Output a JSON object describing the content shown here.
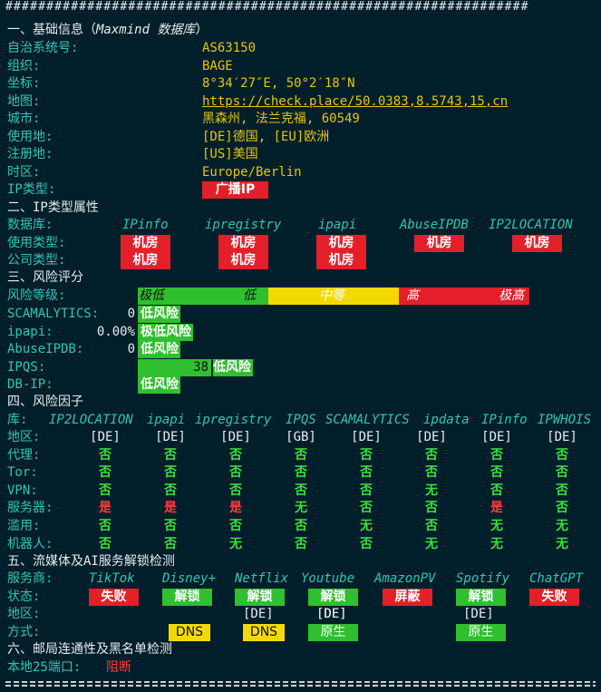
{
  "top_separator": "################################################################",
  "s1": {
    "title": "一、基础信息（",
    "title_db": "Maxmind 数据库",
    "title_end": "）",
    "rows": [
      {
        "label": "自治系统号:",
        "value": "AS63150"
      },
      {
        "label": "组织:",
        "value": "BAGE"
      },
      {
        "label": "坐标:",
        "value": "8°34′27″E, 50°2′18″N"
      },
      {
        "label": "地图:",
        "value": "https://check.place/50.0383,8.5743,15,cn"
      },
      {
        "label": "城市:",
        "value": "黑森州, 法兰克福, 60549"
      },
      {
        "label": "使用地:",
        "value": "[DE]德国, [EU]欧洲"
      },
      {
        "label": "注册地:",
        "value": "[US]美国"
      },
      {
        "label": "时区:",
        "value": "Europe/Berlin"
      }
    ],
    "ip_type_label": "IP类型:",
    "ip_type_value": "广播IP"
  },
  "s2": {
    "title": "二、IP类型属性",
    "db_label": "数据库:",
    "dbs": [
      "IPinfo",
      "ipregistry",
      "ipapi",
      "AbuseIPDB",
      "IP2LOCATION"
    ],
    "usage_label": "使用类型:",
    "usage": [
      "机房",
      "机房",
      "机房",
      "机房",
      "机房"
    ],
    "company_label": "公司类型:",
    "company": [
      "机房",
      "机房",
      "机房"
    ]
  },
  "s3": {
    "title": "三、风险评分",
    "level_label": "风险等级:",
    "levels": [
      "极低",
      "低",
      "中等",
      "高",
      "极高"
    ],
    "rows": [
      {
        "label": "SCAMALYTICS:",
        "score": "0",
        "text": "低风险",
        "fraction": 0
      },
      {
        "label": "ipapi:",
        "score": "0.00%",
        "text": "极低风险",
        "fraction": 0
      },
      {
        "label": "AbuseIPDB:",
        "score": "0",
        "text": "低风险",
        "fraction": 0
      },
      {
        "label": "IPQS:",
        "score": "38",
        "text": "低风险",
        "fraction": 0.38
      },
      {
        "label": "DB-IP:",
        "score": "",
        "text": "低风险",
        "fraction": 0
      }
    ]
  },
  "s4": {
    "title": "四、风险因子",
    "lib_label": "库:",
    "libs": [
      "IP2LOCATION",
      "ipapi",
      "ipregistry",
      "IPQS",
      "SCAMALYTICS",
      "ipdata",
      "IPinfo",
      "IPWHOIS"
    ],
    "rows": [
      {
        "label": "地区:",
        "cells": [
          "[DE]",
          "[DE]",
          "[DE]",
          "[GB]",
          "[DE]",
          "[DE]",
          "[DE]",
          "[DE]"
        ],
        "colors": [
          "w",
          "w",
          "w",
          "w",
          "w",
          "w",
          "w",
          "w"
        ]
      },
      {
        "label": "代理:",
        "cells": [
          "否",
          "否",
          "否",
          "否",
          "否",
          "否",
          "否",
          "否"
        ],
        "colors": [
          "g",
          "g",
          "g",
          "g",
          "g",
          "g",
          "g",
          "g"
        ]
      },
      {
        "label": "Tor:",
        "cells": [
          "否",
          "否",
          "否",
          "否",
          "否",
          "否",
          "否",
          "否"
        ],
        "colors": [
          "g",
          "g",
          "g",
          "g",
          "g",
          "g",
          "g",
          "g"
        ]
      },
      {
        "label": "VPN:",
        "cells": [
          "否",
          "否",
          "否",
          "否",
          "否",
          "无",
          "否",
          "否"
        ],
        "colors": [
          "g",
          "g",
          "g",
          "g",
          "g",
          "g",
          "g",
          "g"
        ]
      },
      {
        "label": "服务器:",
        "cells": [
          "是",
          "是",
          "是",
          "无",
          "否",
          "否",
          "是",
          "否"
        ],
        "colors": [
          "r",
          "r",
          "r",
          "g",
          "g",
          "g",
          "r",
          "g"
        ]
      },
      {
        "label": "滥用:",
        "cells": [
          "否",
          "否",
          "否",
          "否",
          "无",
          "否",
          "无",
          "无"
        ],
        "colors": [
          "g",
          "g",
          "g",
          "g",
          "g",
          "g",
          "g",
          "g"
        ]
      },
      {
        "label": "机器人:",
        "cells": [
          "否",
          "否",
          "无",
          "否",
          "否",
          "无",
          "无",
          "无"
        ],
        "colors": [
          "g",
          "g",
          "g",
          "g",
          "g",
          "g",
          "g",
          "g"
        ]
      }
    ]
  },
  "s5": {
    "title": "五、流媒体及AI服务解锁检测",
    "svc_label": "服务商:",
    "services": [
      "TikTok",
      "Disney+",
      "Netflix",
      "Youtube",
      "AmazonPV",
      "Spotify",
      "ChatGPT"
    ],
    "status_label": "状态:",
    "status": [
      "失败",
      "解锁",
      "解锁",
      "解锁",
      "屏蔽",
      "解锁",
      "失败"
    ],
    "status_colors": [
      "red",
      "green",
      "green",
      "green",
      "red",
      "green",
      "red"
    ],
    "region_label": "地区:",
    "regions": [
      "",
      "[DE]",
      "[DE]",
      "[DE]",
      "",
      "[DE]",
      ""
    ],
    "method_label": "方式:",
    "methods": [
      "",
      "DNS",
      "DNS",
      "原生",
      "",
      "原生",
      ""
    ],
    "method_colors": [
      "",
      "yel",
      "yel",
      "green",
      "",
      "green",
      ""
    ]
  },
  "s6": {
    "title": "六、邮局连通性及黑名单检测",
    "port_label": "本地25端口:",
    "port_value": "阻断"
  },
  "colors": {
    "background": "#011f2a",
    "cyan": "#2ec4b6",
    "yellow": "#e5c60a",
    "red": "#e3202a",
    "green": "#2fbf2f"
  }
}
